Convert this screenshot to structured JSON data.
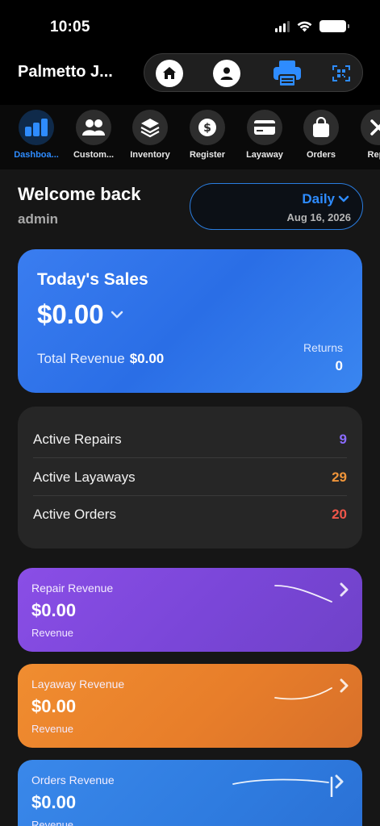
{
  "status": {
    "time": "10:05"
  },
  "header": {
    "store_name": "Palmetto J...",
    "icons": [
      "home-icon",
      "user-icon",
      "printer-icon",
      "scan-icon"
    ]
  },
  "nav": {
    "items": [
      {
        "label": "Dashboa...",
        "icon": "bar-chart-icon",
        "active": true
      },
      {
        "label": "Custom...",
        "icon": "customers-icon"
      },
      {
        "label": "Inventory",
        "icon": "layers-icon"
      },
      {
        "label": "Register",
        "icon": "dollar-icon"
      },
      {
        "label": "Layaway",
        "icon": "card-icon"
      },
      {
        "label": "Orders",
        "icon": "bag-icon"
      },
      {
        "label": "Repa",
        "icon": "tools-icon"
      }
    ]
  },
  "welcome": {
    "title": "Welcome back",
    "user": "admin"
  },
  "date_picker": {
    "mode": "Daily",
    "date": "Aug 16, 2026"
  },
  "sales": {
    "title": "Today's Sales",
    "amount": "$0.00",
    "total_revenue_label": "Total Revenue",
    "total_revenue_value": "$0.00",
    "returns_label": "Returns",
    "returns_value": "0"
  },
  "stats": [
    {
      "label": "Active Repairs",
      "value": "9",
      "color": "#8a6cff"
    },
    {
      "label": "Active Layaways",
      "value": "29",
      "color": "#f0953a"
    },
    {
      "label": "Active Orders",
      "value": "20",
      "color": "#f0564a"
    }
  ],
  "revenue_cards": [
    {
      "title": "Repair Revenue",
      "amount": "$0.00",
      "sub": "Revenue"
    },
    {
      "title": "Layaway Revenue",
      "amount": "$0.00",
      "sub": "Revenue"
    },
    {
      "title": "Orders Revenue",
      "amount": "$0.00",
      "sub": "Revenue"
    }
  ],
  "colors": {
    "accent": "#2e8cff",
    "background": "#000000"
  }
}
